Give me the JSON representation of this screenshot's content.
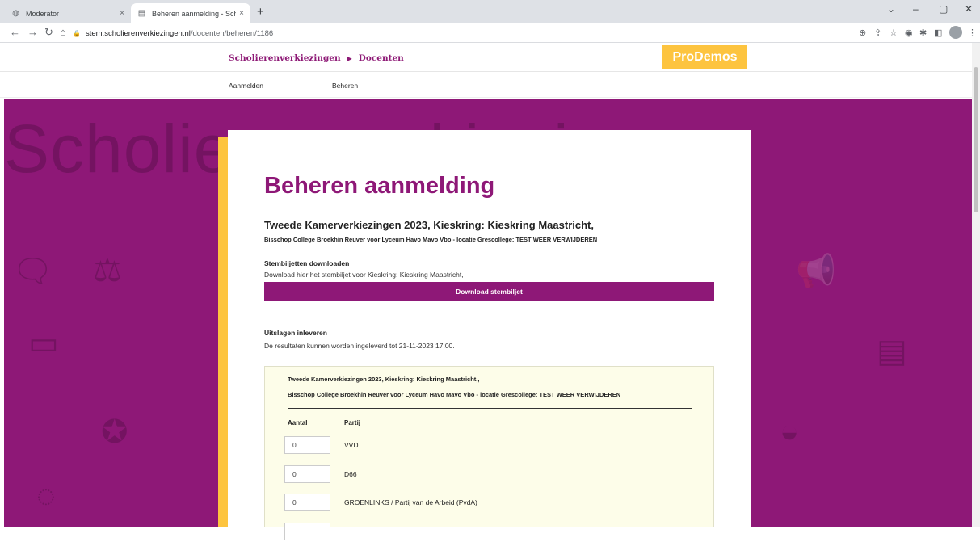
{
  "browser": {
    "tabs": [
      {
        "title": "Moderator",
        "close": "×"
      },
      {
        "title": "Beheren aanmelding - Scholieren...",
        "close": "×"
      }
    ],
    "new_tab": "+",
    "url_host": "stem.scholierenverkiezingen.nl",
    "url_path": "/docenten/beheren/1186"
  },
  "header": {
    "crumb_1": "Scholierenverkiezingen",
    "crumb_sep": "▶",
    "crumb_2": "Docenten",
    "logo": "ProDemos"
  },
  "subnav": {
    "item_1": "Aanmelden",
    "item_2": "Beheren"
  },
  "hero": {
    "background_word": "Scholierenverkiezingen",
    "color": "#8e1877"
  },
  "card": {
    "title": "Beheren aanmelding",
    "election": "Tweede Kamerverkiezingen 2023, Kieskring: Kieskring Maastricht,",
    "school": "Bisschop College Broekhin Reuver voor Lyceum Havo Mavo Vbo - locatie Grescollege: TEST WEER VERWIJDEREN",
    "download_heading": "Stembiljetten downloaden",
    "download_text": "Download hier het stembiljet voor Kieskring: Kieskring Maastricht,",
    "download_button": "Download stembiljet",
    "results_heading": "Uitslagen inleveren",
    "results_text": "De resultaten kunnen worden ingeleverd tot 21-11-2023 17:00."
  },
  "results_form": {
    "election": "Tweede Kamerverkiezingen 2023, Kieskring: Kieskring Maastricht,,",
    "school": "Bisschop College Broekhin Reuver voor Lyceum Havo Mavo Vbo - locatie Grescollege: TEST WEER VERWIJDEREN",
    "col_count": "Aantal",
    "col_party": "Partij",
    "rows": [
      {
        "count": "0",
        "party": "VVD"
      },
      {
        "count": "0",
        "party": "D66"
      },
      {
        "count": "0",
        "party": "GROENLINKS / Partij van de Arbeid (PvdA)"
      }
    ]
  },
  "colors": {
    "accent": "#8e1877",
    "yellow": "#fdc43f"
  }
}
